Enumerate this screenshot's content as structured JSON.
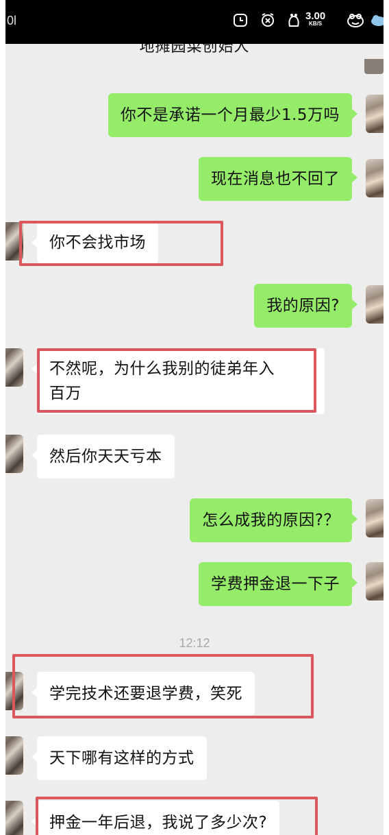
{
  "status_bar": {
    "left_text": "0l",
    "net_speed_value": "3.00",
    "net_speed_unit": "KB/S",
    "icons": [
      "alarm-clock-icon",
      "mute-alarm-icon",
      "pet-icon",
      "frog-icon",
      "cloud-icon"
    ]
  },
  "header": {
    "title": "地摊园菜创始人"
  },
  "timestamp": "12:12",
  "messages": [
    {
      "side": "sent",
      "text": "你不是承诺一个月最少1.5万吗",
      "highlighted": false
    },
    {
      "side": "sent",
      "text": "现在消息也不回了",
      "highlighted": false
    },
    {
      "side": "recv",
      "text": "你不会找市场",
      "highlighted": true
    },
    {
      "side": "sent",
      "text": "我的原因?",
      "highlighted": false
    },
    {
      "side": "recv",
      "line1": "不然呢，为什么我别的徒弟年入",
      "line2": "百万",
      "highlighted": true
    },
    {
      "side": "recv",
      "text": "然后你天天亏本",
      "highlighted": false
    },
    {
      "side": "sent",
      "text": "怎么成我的原因?？",
      "highlighted": false
    },
    {
      "side": "sent",
      "text": "学费押金退一下子",
      "highlighted": false
    },
    {
      "side": "recv",
      "text": "学完技术还要退学费，笑死",
      "highlighted": true
    },
    {
      "side": "recv",
      "text": "天下哪有这样的方式",
      "highlighted": false
    },
    {
      "side": "recv",
      "text": "押金一年后退，我说了多少次?",
      "highlighted": true
    }
  ],
  "colors": {
    "sent_bubble": "#95ec69",
    "recv_bubble": "#ffffff",
    "chat_background": "#ededed",
    "highlight_border": "#d9575d"
  }
}
